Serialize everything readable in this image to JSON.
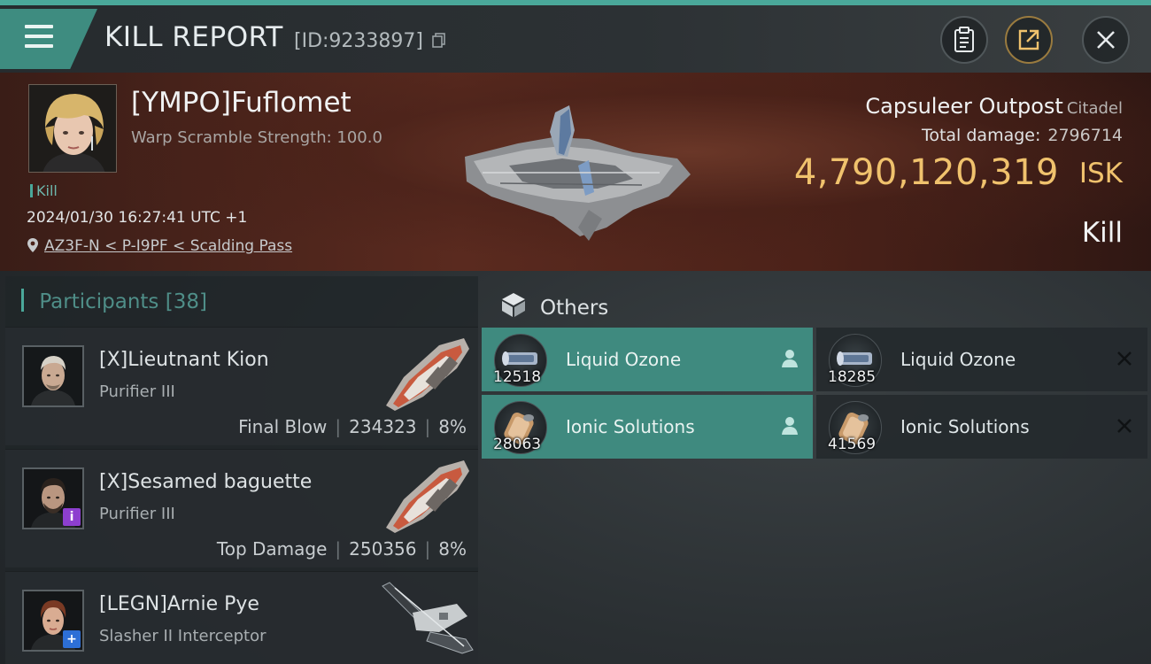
{
  "header": {
    "title": "KILL REPORT",
    "kill_id": "[ID:9233897]"
  },
  "victim": {
    "name": "[YMPO]Fuflomet",
    "subtitle": "Warp Scramble Strength: 100.0",
    "tag": "Kill",
    "datetime": "2024/01/30 16:27:41 UTC +1",
    "location": "AZ3F-N < P-I9PF < Scalding Pass",
    "ship_name": "Capsuleer Outpost",
    "ship_type": "Citadel",
    "total_damage_label": "Total damage:",
    "total_damage_value": "2796714",
    "isk_value": "4,790,120,319",
    "isk_unit": "ISK",
    "result": "Kill"
  },
  "participants": {
    "title": "Participants",
    "count": "[38]",
    "rows": [
      {
        "name": "[X]Lieutnant Kion",
        "ship": "Purifier III",
        "role": "Final Blow",
        "damage": "234323",
        "percent": "8%"
      },
      {
        "name": "[X]Sesamed baguette",
        "ship": "Purifier III",
        "role": "Top Damage",
        "damage": "250356",
        "percent": "8%",
        "badge": "i"
      },
      {
        "name": "[LEGN]Arnie Pye",
        "ship": "Slasher II Interceptor",
        "badge": "+"
      }
    ]
  },
  "others": {
    "title": "Others",
    "items": [
      {
        "name": "Liquid Ozone",
        "qty": "12518",
        "state": "dropped",
        "icon": "person-icon"
      },
      {
        "name": "Liquid Ozone",
        "qty": "18285",
        "state": "destroyed",
        "icon": "close-icon"
      },
      {
        "name": "Ionic Solutions",
        "qty": "28063",
        "state": "dropped",
        "icon": "person-icon"
      },
      {
        "name": "Ionic Solutions",
        "qty": "41569",
        "state": "destroyed",
        "icon": "close-icon"
      }
    ]
  },
  "colors": {
    "accent": "#4aa89a",
    "isk": "#f0c26d",
    "banner": "#5a2a1f"
  }
}
